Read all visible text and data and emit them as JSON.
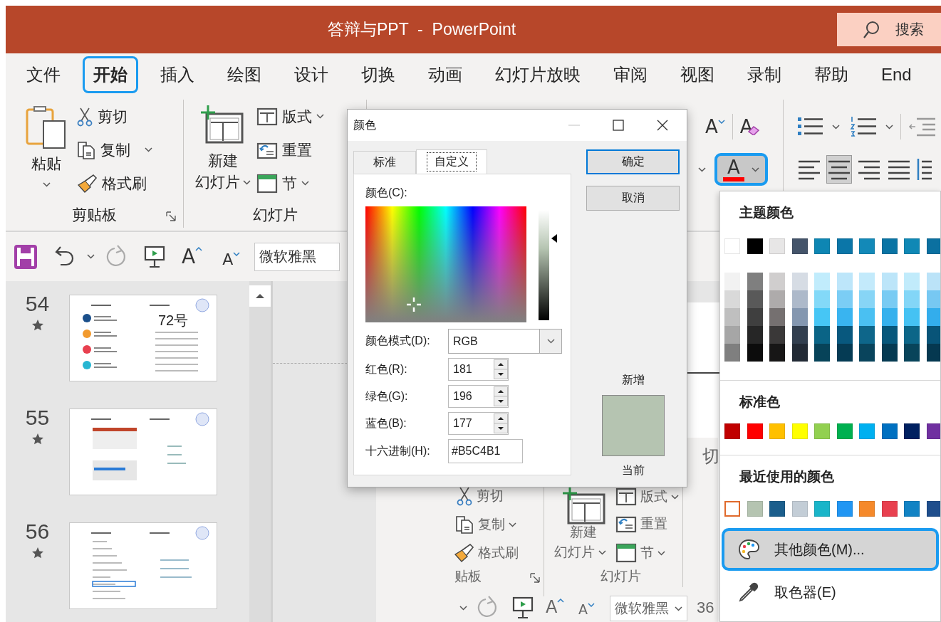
{
  "window": {
    "title": "答辩与PPT  -  PowerPoint",
    "search": "搜索"
  },
  "tabs": [
    {
      "label": "文件",
      "selected": false
    },
    {
      "label": "开始",
      "selected": true
    },
    {
      "label": "插入",
      "selected": false
    },
    {
      "label": "绘图",
      "selected": false
    },
    {
      "label": "设计",
      "selected": false
    },
    {
      "label": "切换",
      "selected": false
    },
    {
      "label": "动画",
      "selected": false
    },
    {
      "label": "幻灯片放映",
      "selected": false
    },
    {
      "label": "审阅",
      "selected": false
    },
    {
      "label": "视图",
      "selected": false
    },
    {
      "label": "录制",
      "selected": false
    },
    {
      "label": "帮助",
      "selected": false
    },
    {
      "label": "End",
      "selected": false
    }
  ],
  "ribbon": {
    "clipboard": {
      "paste": "粘贴",
      "cut": "剪切",
      "copy": "复制",
      "format_painter": "格式刷",
      "label": "剪贴板"
    },
    "slides": {
      "new_slide": [
        "新建",
        "幻灯片"
      ],
      "layout": "版式",
      "reset": "重置",
      "section": "节",
      "label": "幻灯片"
    },
    "font": {
      "shrink_font": "A",
      "clear_formatting": "A",
      "font_color": {
        "glyph": "A",
        "expanded": true
      }
    },
    "paragraph": {
      "alignments": [
        {
          "selected": false
        },
        {
          "selected": true
        },
        {
          "selected": false
        },
        {
          "selected": false
        }
      ]
    }
  },
  "quick_access": {
    "grow_font": "A",
    "shrink_font": "A",
    "font": "微软雅黑"
  },
  "thumbnails": [
    {
      "number": "54",
      "caption": "72号"
    },
    {
      "number": "55"
    },
    {
      "number": "56"
    }
  ],
  "slide_picture": {
    "tab": "切",
    "cut": "剪切",
    "copy": "复制",
    "format_painter": "格式刷",
    "clipboard_label": "贴板",
    "new_slide": [
      "新建",
      "幻灯片"
    ],
    "layout": "版式",
    "reset": "重置",
    "section": "节",
    "slides_label": "幻灯片",
    "grow_font": "A",
    "shrink_font": "A",
    "font": "微软雅黑",
    "font_size": "36"
  },
  "color_dialog": {
    "title": "颜色",
    "tabs": [
      {
        "label": "标准",
        "selected": false
      },
      {
        "label": "自定义",
        "selected": true
      }
    ],
    "color_label": "颜色(C):",
    "luminance": {
      "level": 0.74
    },
    "mode": {
      "label": "颜色模式(D):",
      "value": "RGB"
    },
    "channels": [
      {
        "label": "红色(R):",
        "value": "181"
      },
      {
        "label": "绿色(G):",
        "value": "196"
      },
      {
        "label": "蓝色(B):",
        "value": "177"
      }
    ],
    "hex": {
      "label": "十六进制(H):",
      "value": "#B5C4B1"
    },
    "buttons": [
      {
        "label": "确定",
        "default": true
      },
      {
        "label": "取消",
        "default": false
      }
    ],
    "preview": [
      {
        "label": "新增",
        "color": "#b5c4b1"
      },
      {
        "label": "当前",
        "color": "#b5c4b1"
      }
    ]
  },
  "color_menu": {
    "theme_title": "主题颜色",
    "theme_colors": [
      {
        "color": "#ffffff",
        "shades": [
          {
            "color": "#f2f2f2"
          },
          {
            "color": "#d9d9d9"
          },
          {
            "color": "#bfbfbf"
          },
          {
            "color": "#a6a6a6"
          },
          {
            "color": "#7f7f7f"
          }
        ]
      },
      {
        "color": "#000000",
        "shades": [
          {
            "color": "#7f7f7f"
          },
          {
            "color": "#595959"
          },
          {
            "color": "#3f3f3f"
          },
          {
            "color": "#262626"
          },
          {
            "color": "#0c0c0c"
          }
        ]
      },
      {
        "color": "#e7e6e6",
        "shades": [
          {
            "color": "#d0cece"
          },
          {
            "color": "#aeabab"
          },
          {
            "color": "#757070"
          },
          {
            "color": "#3a3838"
          },
          {
            "color": "#171616"
          }
        ]
      },
      {
        "color": "#44546a",
        "shades": [
          {
            "color": "#d6dce4"
          },
          {
            "color": "#adb9ca"
          },
          {
            "color": "#8497b0"
          },
          {
            "color": "#323f4f"
          },
          {
            "color": "#222a35"
          }
        ]
      },
      {
        "color": "#0e86b3",
        "shades": [
          {
            "color": "#c1ecfc"
          },
          {
            "color": "#83d9f8"
          },
          {
            "color": "#46c6f5"
          },
          {
            "color": "#0a6486"
          },
          {
            "color": "#074359"
          }
        ]
      },
      {
        "color": "#0b76a8",
        "shades": [
          {
            "color": "#bde6fa"
          },
          {
            "color": "#7bcdf5"
          },
          {
            "color": "#39b4f0"
          },
          {
            "color": "#08587e"
          },
          {
            "color": "#053b54"
          }
        ]
      },
      {
        "color": "#1389b8",
        "shades": [
          {
            "color": "#c3eafb"
          },
          {
            "color": "#87d5f6"
          },
          {
            "color": "#4ac0f2"
          },
          {
            "color": "#0e668a"
          },
          {
            "color": "#09445c"
          }
        ]
      },
      {
        "color": "#0a74a4",
        "shades": [
          {
            "color": "#bce5f9"
          },
          {
            "color": "#79cbf3"
          },
          {
            "color": "#36b1ed"
          },
          {
            "color": "#07577b"
          },
          {
            "color": "#053a52"
          }
        ]
      },
      {
        "color": "#1088b5",
        "shades": [
          {
            "color": "#c1ebfb"
          },
          {
            "color": "#83d6f7"
          },
          {
            "color": "#45c2f3"
          },
          {
            "color": "#0c6688"
          },
          {
            "color": "#08445a"
          }
        ]
      },
      {
        "color": "#0b70a0",
        "shades": [
          {
            "color": "#bbe3f8"
          },
          {
            "color": "#77c8f2"
          },
          {
            "color": "#33adec"
          },
          {
            "color": "#085478"
          },
          {
            "color": "#053850"
          }
        ]
      }
    ],
    "standard_title": "标准色",
    "standard_colors": [
      {
        "color": "#c00000"
      },
      {
        "color": "#ff0000"
      },
      {
        "color": "#ffc000"
      },
      {
        "color": "#ffff00"
      },
      {
        "color": "#92d050"
      },
      {
        "color": "#00b050"
      },
      {
        "color": "#00b0f0"
      },
      {
        "color": "#0070c0"
      },
      {
        "color": "#002060"
      },
      {
        "color": "#7030a0"
      }
    ],
    "recent_title": "最近使用的颜色",
    "recent_colors": [
      {
        "color": "#ffffff",
        "selected": true
      },
      {
        "color": "#b5c4b1",
        "selected": false
      },
      {
        "color": "#1b5e8c",
        "selected": false
      },
      {
        "color": "#c3cdd6",
        "selected": false
      },
      {
        "color": "#1ab5c9",
        "selected": false
      },
      {
        "color": "#2196f3",
        "selected": false
      },
      {
        "color": "#f5892a",
        "selected": false
      },
      {
        "color": "#e8404f",
        "selected": false
      },
      {
        "color": "#1283c4",
        "selected": false
      },
      {
        "color": "#1f4e8c",
        "selected": false
      }
    ],
    "items": [
      {
        "kind": "more",
        "label": "其他颜色(M)...",
        "selected": true
      },
      {
        "kind": "eyedropper",
        "label": "取色器(E)",
        "selected": false
      }
    ]
  }
}
